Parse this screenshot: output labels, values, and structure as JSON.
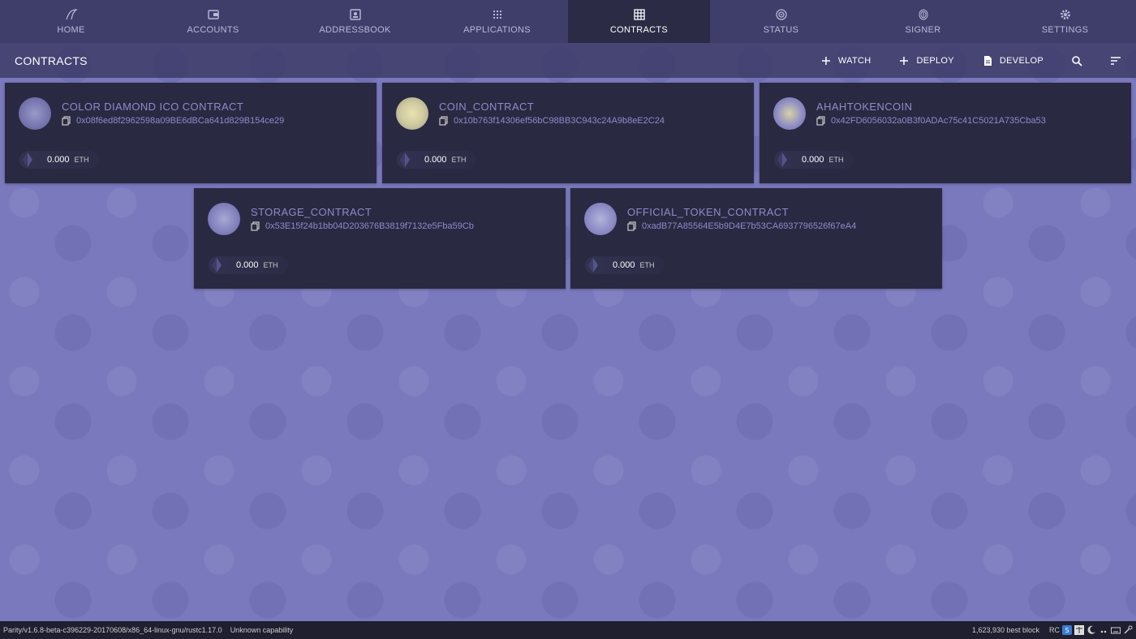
{
  "nav": [
    {
      "label": "HOME",
      "icon": "parity-logo-icon"
    },
    {
      "label": "ACCOUNTS",
      "icon": "wallet-icon"
    },
    {
      "label": "ADDRESSBOOK",
      "icon": "addressbook-icon"
    },
    {
      "label": "APPLICATIONS",
      "icon": "apps-grid-icon"
    },
    {
      "label": "CONTRACTS",
      "icon": "table-grid-icon"
    },
    {
      "label": "STATUS",
      "icon": "status-signal-icon"
    },
    {
      "label": "SIGNER",
      "icon": "fingerprint-icon"
    },
    {
      "label": "SETTINGS",
      "icon": "gear-icon"
    }
  ],
  "active_nav": "CONTRACTS",
  "page": {
    "title": "CONTRACTS"
  },
  "actions": {
    "watch": "WATCH",
    "deploy": "DEPLOY",
    "develop": "DEVELOP"
  },
  "contracts": [
    {
      "name": "COLOR DIAMOND ICO CONTRACT",
      "address": "0x08f6ed8f2962598a09BE6dBCa641d829B154ce29",
      "balance": "0.000",
      "unit": "ETH"
    },
    {
      "name": "COIN_CONTRACT",
      "address": "0x10b763f14306ef56bC98BB3C943c24A9b8eE2C24",
      "balance": "0.000",
      "unit": "ETH"
    },
    {
      "name": "AHAHTOKENCOIN",
      "address": "0x42FD6056032a0B3f0ADAc75c41C5021A735Cba53",
      "balance": "0.000",
      "unit": "ETH"
    },
    {
      "name": "STORAGE_CONTRACT",
      "address": "0x53E15f24b1bb04D203676B3819f7132e5Fba59Cb",
      "balance": "0.000",
      "unit": "ETH"
    },
    {
      "name": "OFFICIAL_TOKEN_CONTRACT",
      "address": "0xadB77A85564E5b9D4E7b53CA6937796526f67eA4",
      "balance": "0.000",
      "unit": "ETH"
    }
  ],
  "status": {
    "version": "Parity/v1.6.8-beta-c396229-20170608/x86_64-linux-gnu/rustc1.17.0",
    "capability": "Unknown capability",
    "block": "1,623,930 best block",
    "tray_text": "RC"
  },
  "colors": {
    "nav_bg": "#3f3e6a",
    "nav_active": "#2c2b45",
    "card_bg": "#2a2942",
    "accent_text": "#8d8bc8",
    "background": "#7a79bd"
  }
}
